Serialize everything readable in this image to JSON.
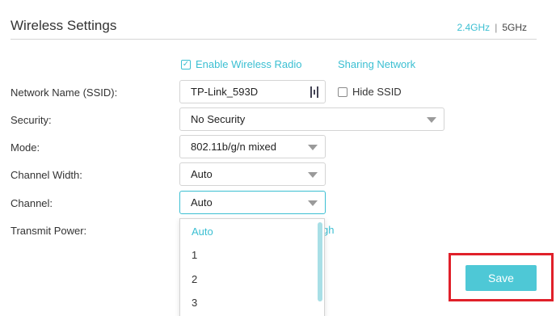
{
  "header": {
    "title": "Wireless Settings",
    "band_24": "2.4GHz",
    "separator": "|",
    "band_5": "5GHz"
  },
  "enable_radio": {
    "label": "Enable Wireless Radio",
    "checked": true
  },
  "sharing_link": "Sharing Network",
  "form": {
    "ssid": {
      "label": "Network Name (SSID):",
      "value": "TP-Link_593D"
    },
    "hide_ssid": {
      "label": "Hide SSID",
      "checked": false
    },
    "security": {
      "label": "Security:",
      "value": "No Security"
    },
    "mode": {
      "label": "Mode:",
      "value": "802.11b/g/n mixed"
    },
    "channel_width": {
      "label": "Channel Width:",
      "value": "Auto"
    },
    "channel": {
      "label": "Channel:",
      "value": "Auto"
    },
    "transmit_power": {
      "label": "Transmit Power:",
      "partial_value": "gh"
    }
  },
  "channel_dropdown": {
    "options": [
      "Auto",
      "1",
      "2",
      "3"
    ],
    "selected": "Auto"
  },
  "save_label": "Save",
  "colors": {
    "accent": "#3bbfd2",
    "save": "#4ec8d6",
    "highlight": "#e0202a"
  }
}
